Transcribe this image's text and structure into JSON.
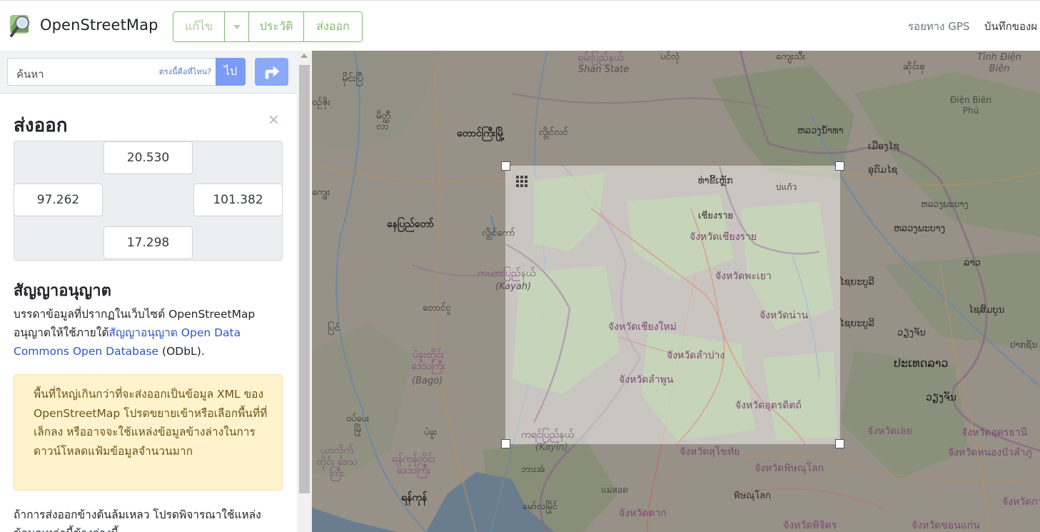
{
  "header": {
    "logo_text": "OpenStreetMap",
    "edit_label": "แก้ไข",
    "history_label": "ประวัติ",
    "export_label": "ส่งออก",
    "gps_traces": "รอยทาง GPS",
    "user_diaries": "บันทึกของผ"
  },
  "search": {
    "placeholder": "ค้นหา",
    "where_am_i": "ตรงนี้คือที่ไหน?",
    "go_label": "ไป"
  },
  "export_panel": {
    "title": "ส่งออก",
    "close": "×",
    "bbox": {
      "north": "20.530",
      "west": "97.262",
      "east": "101.382",
      "south": "17.298"
    },
    "license_title": "สัญญาอนุญาต",
    "license_prefix": "บรรดาข้อมูลที่ปรากฏในเว็บไซต์ OpenStreetMap อนุญาตให้ใช้ภายใต้",
    "license_link": "สัญญาอนุญาต Open Data Commons Open Database",
    "license_suffix": " (ODbL).",
    "warning": "พื้นที่ใหญ่เกินกว่าที่จะส่งออกเป็นข้อมูล XML ของ OpenStreetMap โปรดขยายเข้าหรือเลือกพื้นที่ที่เล็กลง หรืออาจจะใช้แหล่งข้อมูลข้างล่างในการดาวน์โหลดแฟ้มข้อมูลจำนวนมาก",
    "fail_text": "ถ้าการส่งออกข้างต้นล้มเหลว โปรดพิจารณาใช้แหล่งข้อมูลเหล่านี้ข้างล่างนี้"
  },
  "map": {
    "labels": [
      {
        "text": "ရှမ်းပြည်နယ်",
        "cls": "pr"
      },
      {
        "text": "Shan State",
        "cls": "it"
      },
      {
        "text": "ပင်လုံ",
        "cls": "sm"
      },
      {
        "text": "ကျေးသီး",
        "cls": "sm"
      },
      {
        "text": "Tỉnh Điện Biên",
        "cls": "it"
      },
      {
        "text": "ဆိုင်းစု",
        "cls": "sm"
      },
      {
        "text": "မိုင်းပြီ",
        "cls": ""
      },
      {
        "text": "ဝဥ်ဇိုး",
        "cls": "sm"
      },
      {
        "text": "မိတ္ထီလာ",
        "cls": "sm"
      },
      {
        "text": "တောင်ကြီးမြို့",
        "cls": "dark"
      },
      {
        "text": "လွိုင်လင်",
        "cls": "sm"
      },
      {
        "text": "Điện Biên Phủ",
        "cls": "grey"
      },
      {
        "text": "ຫລວງນ້ຳທາ",
        "cls": "sm"
      },
      {
        "text": "ເມືອງໄຊ",
        "cls": "sm"
      },
      {
        "text": "ອຸດົມໄຊ",
        "cls": "sm"
      },
      {
        "text": "ကျွေး",
        "cls": "sm"
      },
      {
        "text": "နေပြည်တော်",
        "cls": "dark"
      },
      {
        "text": "လွိုင်ကော်",
        "cls": "sm"
      },
      {
        "text": "ທ່າຂີ້ເຫຼັກ",
        "cls": "sm"
      },
      {
        "text": "เชียงราย",
        "cls": "sm"
      },
      {
        "text": "จังหวัดเชียงราย",
        "cls": "pr"
      },
      {
        "text": "บ่แก้ว",
        "cls": "grey"
      },
      {
        "text": "ຫລວງພະບາງ",
        "cls": "grey"
      },
      {
        "text": "ຫລວງພະບາງ",
        "cls": "sm"
      },
      {
        "text": "ကယားပြည်နယ်",
        "cls": "pr"
      },
      {
        "text": "(Kayah)",
        "cls": "it"
      },
      {
        "text": "จังหวัดพะเยา",
        "cls": "pr"
      },
      {
        "text": "ໄຊຍະບູລີ",
        "cls": "sm"
      },
      {
        "text": "ລາວ",
        "cls": "sm"
      },
      {
        "text": "တောင်ငူ",
        "cls": "sm"
      },
      {
        "text": "จังหวัดน่าน",
        "cls": "pr"
      },
      {
        "text": "ໄຊສົມບູນ",
        "cls": "sm"
      },
      {
        "text": "ပြင်",
        "cls": "sm"
      },
      {
        "text": "จังหวัดเชียงใหม่",
        "cls": "pr"
      },
      {
        "text": "ໄຊຍະບູລີ",
        "cls": "sm"
      },
      {
        "text": "ວຽງຈັນ",
        "cls": "sm"
      },
      {
        "text": "จังหวัดลำปาง",
        "cls": "pr"
      },
      {
        "text": "ປາກຊັນ",
        "cls": "grey"
      },
      {
        "text": "ပဲခူးတိုင်း ဒေသကြီး",
        "cls": "pr"
      },
      {
        "text": "(Bago)",
        "cls": "it"
      },
      {
        "text": "จังหวัดลำพูน",
        "cls": "pr"
      },
      {
        "text": "ປະເທດລາວ",
        "cls": "dark"
      },
      {
        "text": "ວຽງຈັນ",
        "cls": "dark"
      },
      {
        "text": "จังหวัดอุตรดิตถ์",
        "cls": "pr"
      },
      {
        "text": "ပဲခူး",
        "cls": "sm"
      },
      {
        "text": "ကရင်ပြည်နယ်",
        "cls": "pr"
      },
      {
        "text": "(Kayin)",
        "cls": "it"
      },
      {
        "text": "จังหวัดเลย",
        "cls": "pr"
      },
      {
        "text": "จังหวัดอุดรธานี",
        "cls": "pr"
      },
      {
        "text": "ဝပ်ပေး မြို",
        "cls": "sm"
      },
      {
        "text": "ရန်ကုန်တိုင်း ဒေသကြီး",
        "cls": "pr"
      },
      {
        "text": "ယာလိုက်တိုင်း ဒေသကြီး",
        "cls": "pr"
      },
      {
        "text": "จังหวัดสุโขทัย",
        "cls": "pr"
      },
      {
        "text": "จังหวัดหนองบัวลำภู",
        "cls": "pr"
      },
      {
        "text": "ဘားအံ",
        "cls": "sm"
      },
      {
        "text": "จังหวัดพิษณุโลก",
        "cls": "pr"
      },
      {
        "text": "ရန်ကုန်",
        "cls": "dark"
      },
      {
        "text": "แม่สอด",
        "cls": "grey"
      },
      {
        "text": "พิษณุโลก",
        "cls": "sm"
      },
      {
        "text": "จังหวัดกาฬ",
        "cls": "pr"
      },
      {
        "text": "မော်လမြိုင်",
        "cls": "sm"
      },
      {
        "text": "จังหวัดตาก",
        "cls": "pr"
      },
      {
        "text": "จังหวัดพิจิตร",
        "cls": "pr"
      },
      {
        "text": "จังหวัดขอนแก่น",
        "cls": "pr"
      }
    ]
  },
  "colors": {
    "brand_green": "#7ebc6f",
    "search_button": "#7b9bf5",
    "warning_bg": "#fff3cd",
    "link": "#2e57c8",
    "map_tint": "#979188"
  }
}
